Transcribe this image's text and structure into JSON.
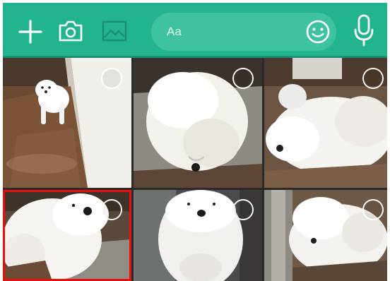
{
  "toolbar": {
    "background": "#22b48f",
    "icons": [
      "plus-icon",
      "camera-icon",
      "image-icon",
      "emoji-icon",
      "microphone-icon"
    ],
    "message_input": {
      "placeholder": "Aa"
    }
  },
  "gallery": {
    "selection_marker_color": "#ffffff",
    "highlight_color": "#e8100c",
    "items": [
      {
        "id": 1,
        "selected": false
      },
      {
        "id": 2,
        "selected": false
      },
      {
        "id": 3,
        "selected": false
      },
      {
        "id": 4,
        "selected": false,
        "highlighted": true
      },
      {
        "id": 5,
        "selected": false
      },
      {
        "id": 6,
        "selected": false
      }
    ]
  }
}
